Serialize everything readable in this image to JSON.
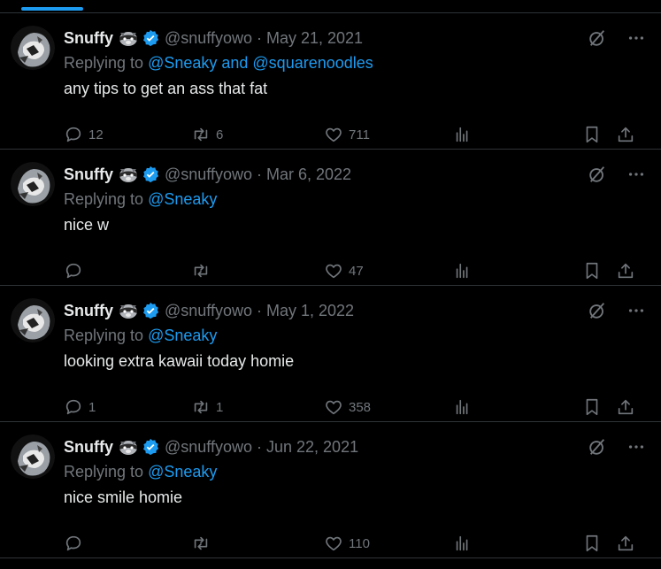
{
  "colors": {
    "accent": "#1d9bf0",
    "muted": "#71767b",
    "text": "#e7e9ea",
    "border": "#2f3336",
    "background": "#000000"
  },
  "tweets": [
    {
      "name": "Snuffy",
      "handle": "@snuffyowo",
      "separator": "·",
      "date": "May 21, 2021",
      "replying_prefix": "Replying to ",
      "mentions": "@Sneaky and @squarenoodles",
      "text": "any tips to get an ass that fat",
      "replies": "12",
      "retweets": "6",
      "likes": "711"
    },
    {
      "name": "Snuffy",
      "handle": "@snuffyowo",
      "separator": "·",
      "date": "Mar 6, 2022",
      "replying_prefix": "Replying to ",
      "mentions": "@Sneaky",
      "text": "nice w",
      "replies": "",
      "retweets": "",
      "likes": "47"
    },
    {
      "name": "Snuffy",
      "handle": "@snuffyowo",
      "separator": "·",
      "date": "May 1, 2022",
      "replying_prefix": "Replying to ",
      "mentions": "@Sneaky",
      "text": "looking extra kawaii today homie",
      "replies": "1",
      "retweets": "1",
      "likes": "358"
    },
    {
      "name": "Snuffy",
      "handle": "@snuffyowo",
      "separator": "·",
      "date": "Jun 22, 2021",
      "replying_prefix": "Replying to ",
      "mentions": "@Sneaky",
      "text": "nice smile homie",
      "replies": "",
      "retweets": "",
      "likes": "110"
    }
  ],
  "icons": {
    "emoji": "raccoon-icon",
    "verified": "verified-badge-icon",
    "grok": "grok-icon",
    "more": "more-icon",
    "reply": "reply-icon",
    "retweet": "retweet-icon",
    "like": "heart-icon",
    "views": "views-icon",
    "bookmark": "bookmark-icon",
    "share": "share-icon"
  }
}
